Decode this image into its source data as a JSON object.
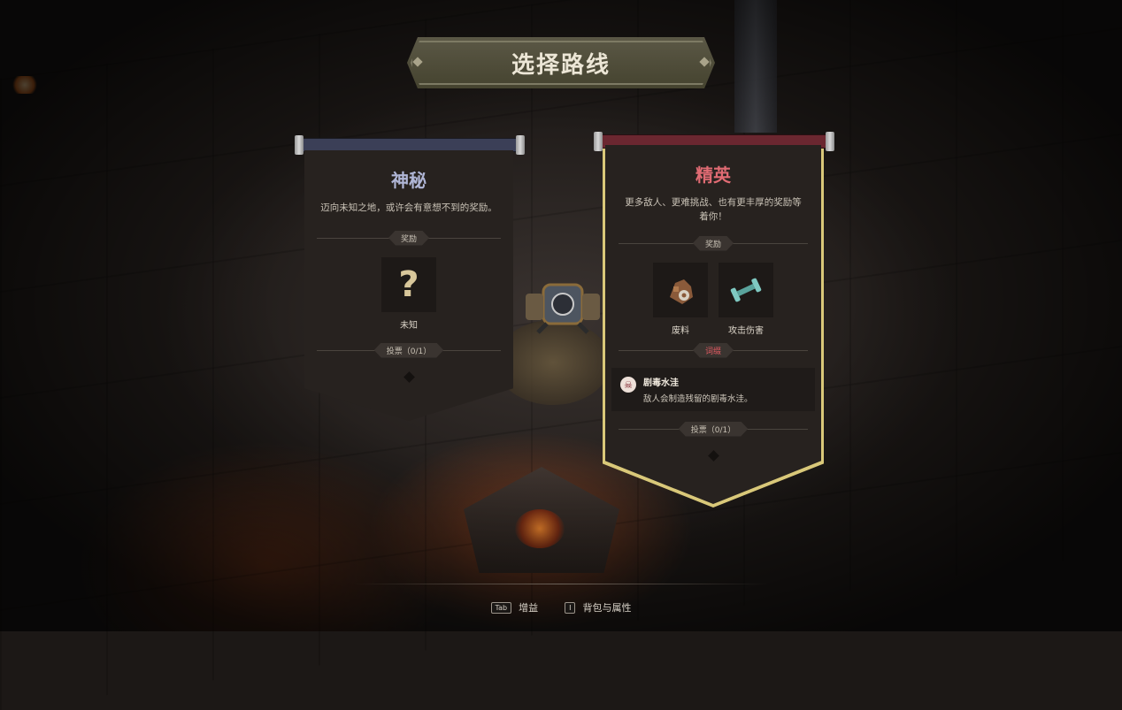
{
  "title": "选择路线",
  "routes": [
    {
      "name": "神秘",
      "desc": "迈向未知之地，或许会有意想不到的奖励。",
      "reward_tag": "奖励",
      "rewards": [
        {
          "label": "未知",
          "icon": "question-mark-icon"
        }
      ],
      "vote": "投票（0/1）",
      "accent": "#b0b6d6",
      "rod_color": "#3b3f57"
    },
    {
      "name": "精英",
      "desc": "更多敌人、更难挑战、也有更丰厚的奖励等着你！",
      "reward_tag": "奖励",
      "rewards": [
        {
          "label": "废料",
          "icon": "scrap-icon"
        },
        {
          "label": "攻击伤害",
          "icon": "dumbbell-icon"
        }
      ],
      "curse_tag": "词缀",
      "curse": {
        "name": "剧毒水洼",
        "desc": "敌人会制造残留的剧毒水洼。",
        "icon": "skull-icon"
      },
      "vote": "投票（0/1）",
      "accent": "#e06b73",
      "rod_color": "#6b2730",
      "selected": true
    }
  ],
  "footer": [
    {
      "key": "Tab",
      "label": "增益"
    },
    {
      "key": "I",
      "label": "背包与属性"
    }
  ]
}
